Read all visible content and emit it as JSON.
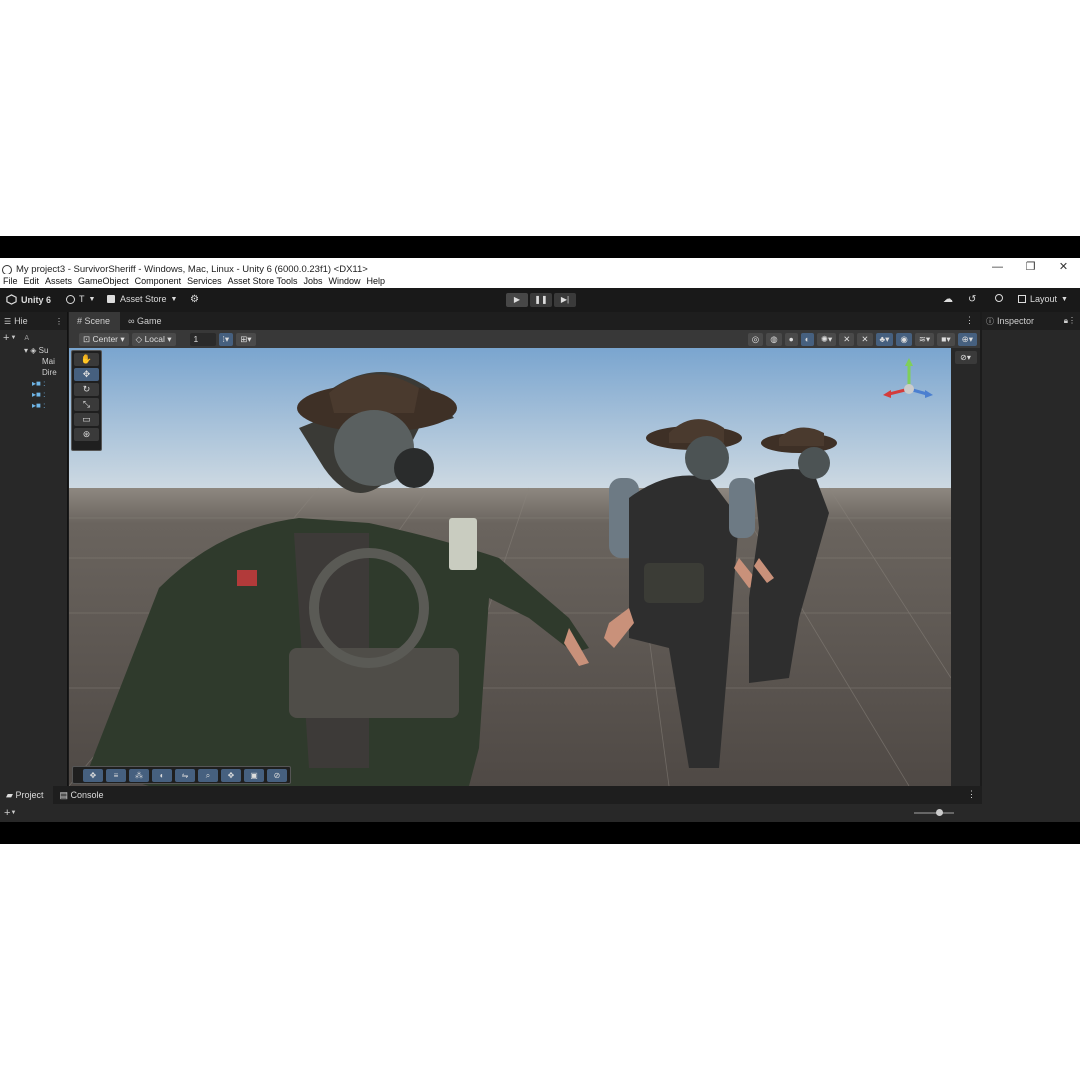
{
  "window": {
    "title": "My project3 - SurvivorSheriff - Windows, Mac, Linux - Unity 6 (6000.0.23f1) <DX11>",
    "controls": [
      "—",
      "❐",
      "✕"
    ]
  },
  "menu": [
    "File",
    "Edit",
    "Assets",
    "GameObject",
    "Component",
    "Services",
    "Asset Store Tools",
    "Jobs",
    "Window",
    "Help"
  ],
  "toolbar": {
    "unity_label": "Unity 6",
    "account_label": "T",
    "asset_store_label": "Asset Store",
    "layout_label": "Layout",
    "play_icons": [
      "▶",
      "❚❚",
      "▶|"
    ]
  },
  "hierarchy": {
    "tab_label": "Hie",
    "search_placeholder": "A",
    "items": [
      "Su",
      "Mai",
      "Dire",
      ":",
      ":",
      ":"
    ]
  },
  "scene": {
    "tabs": [
      "Scene",
      "Game"
    ],
    "pivot_label": "Center",
    "space_label": "Local",
    "grid_value": "1"
  },
  "inspector": {
    "tab_label": "Inspector"
  },
  "bottom": {
    "tabs": [
      "Project",
      "Console"
    ]
  },
  "colors": {
    "sky_top": "#7aa5cf",
    "sky_horizon": "#cdd9e2",
    "ground": "#5a5450",
    "accent": "#46607f"
  },
  "tools": [
    "hand-icon",
    "move-icon",
    "rotate-icon",
    "scale-icon",
    "rect-icon",
    "transform-icon"
  ],
  "overlay_tools": [
    "move-icon",
    "grid-icon",
    "snap-icon",
    "shading-icon",
    "layers-icon",
    "zoom-icon",
    "pan-icon",
    "camera-icon",
    "orbit-icon"
  ]
}
